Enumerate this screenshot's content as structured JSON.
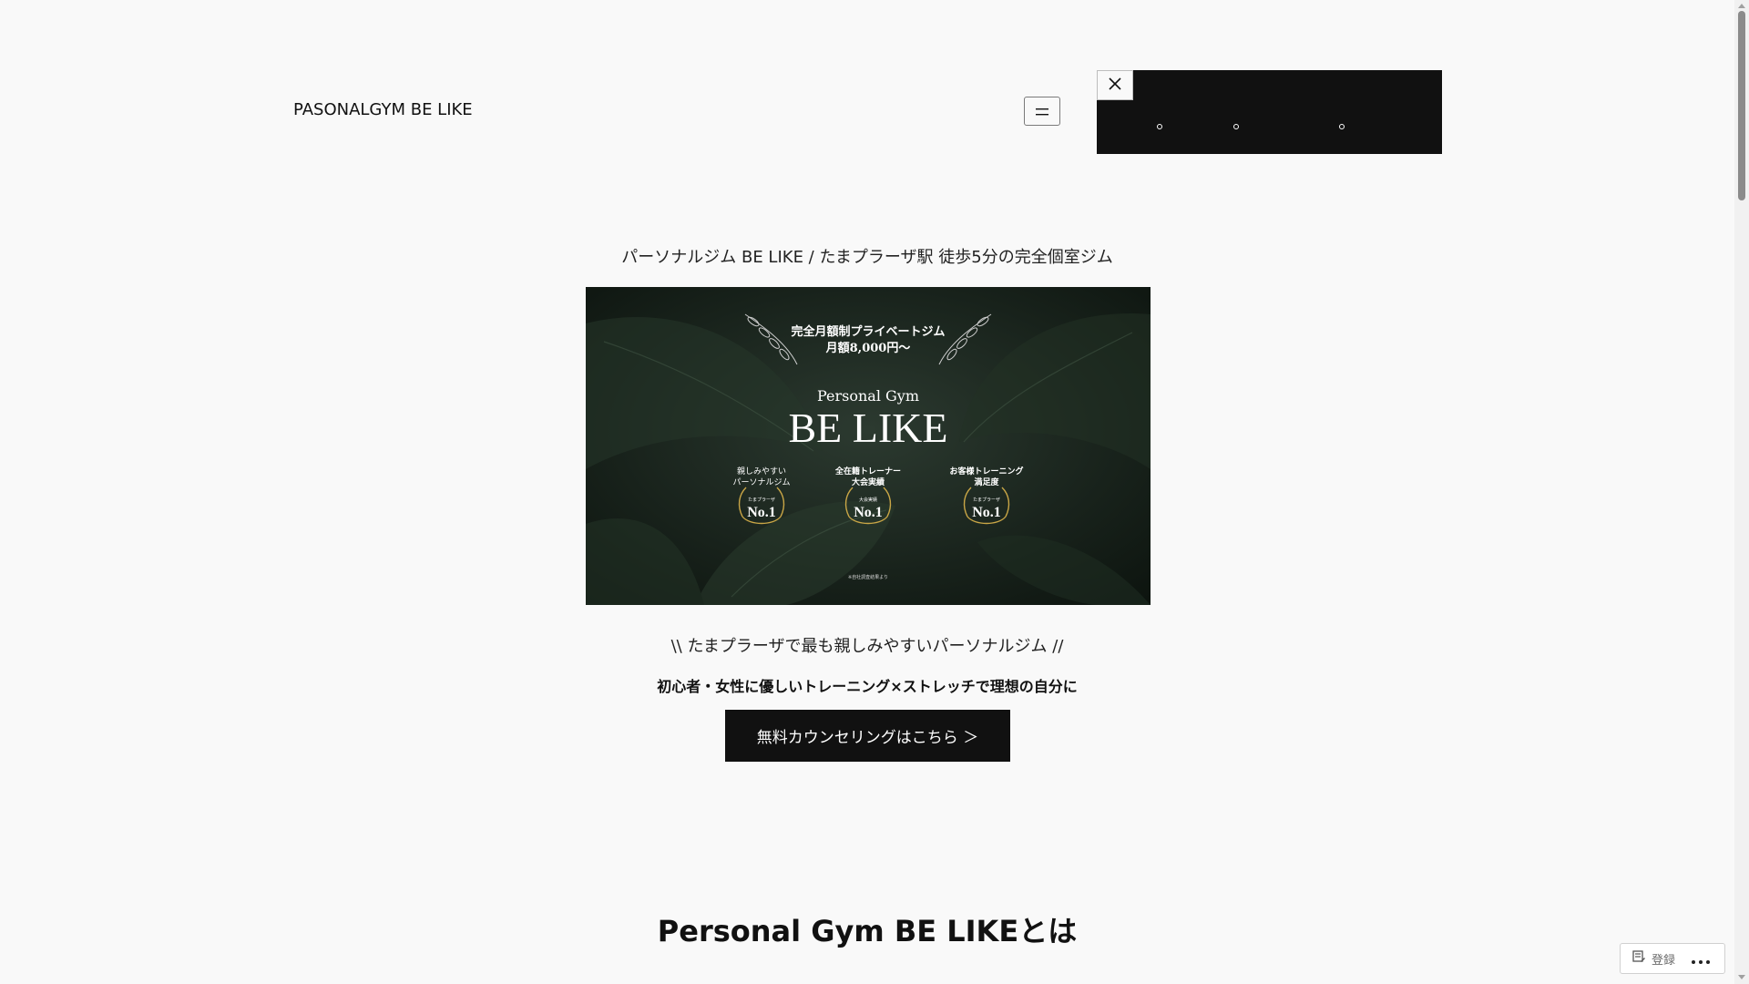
{
  "header": {
    "site_title": "PASONALGYM BE LIKE",
    "menu_open_icon": "hamburger-icon",
    "menu_close_icon": "close-icon"
  },
  "hero": {
    "tagline": "パーソナルジム BE LIKE / たまプラーザ駅 徒歩5分の完全個室ジム",
    "image": {
      "headline_line1": "完全月額制プライベートジム",
      "headline_line2": "月額8,000円〜",
      "brand_small": "Personal Gym",
      "brand_large": "BE LIKE",
      "awards": [
        {
          "line1": "親しみやすい",
          "line2": "パーソナルジム",
          "badge_small": "たまプラーザ",
          "badge_rank": "No.1"
        },
        {
          "line1": "全在籍トレーナー",
          "line2": "大会実績",
          "badge_small": "大会実績",
          "badge_rank": "No.1"
        },
        {
          "line1": "お客様トレーニング",
          "line2": "満足度",
          "badge_small": "たまプラーザ",
          "badge_rank": "No.1"
        }
      ],
      "footnote": "※自社調査結果より"
    },
    "subline": "\\\\ たまプラーザで最も親しみやすいパーソナルジム //",
    "subline_bold": "初心者・女性に優しいトレーニング×ストレッチで理想の自分に",
    "cta_label": "無料カウンセリングはこちら ＞"
  },
  "about": {
    "title": "Personal Gym BE LIKEとは"
  },
  "admin_bar": {
    "register_icon": "register-icon",
    "register_label": "登録",
    "more_icon": "more-icon"
  },
  "colors": {
    "background": "#f9f9f9",
    "text": "#111111",
    "nav_overlay": "#111111",
    "button": "#111111",
    "hero_dark": "#1a241d"
  }
}
